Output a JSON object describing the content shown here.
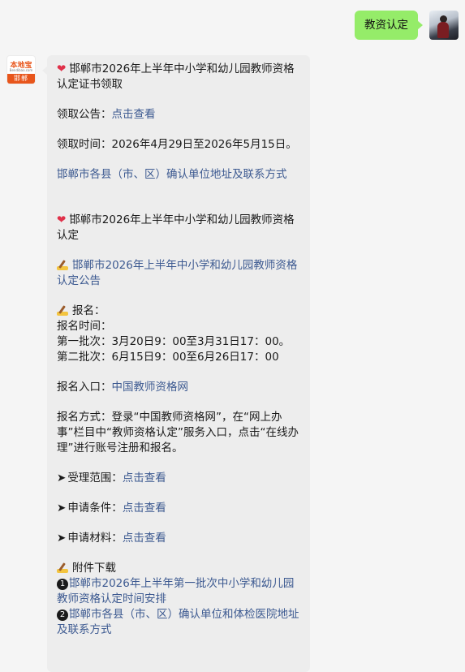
{
  "user_message": "教资认定",
  "bot_avatar": {
    "brand": "本地宝",
    "site": "Bendibao.com",
    "city": "邯郸"
  },
  "message": {
    "cert": {
      "title": "邯郸市2026年上半年中小学和幼儿园教师资格认定证书领取",
      "notice_label": "领取公告：",
      "notice_link": "点击查看",
      "time": "领取时间：2026年4月29日至2026年5月15日。",
      "address_link": "邯郸市各县（市、区）确认单位地址及联系方式"
    },
    "recog": {
      "title": "邯郸市2026年上半年中小学和幼儿园教师资格认定",
      "announcement_link": "邯郸市2026年上半年中小学和幼儿园教师资格认定公告",
      "signup_heading": "报名：",
      "signup_time_label": "报名时间：",
      "batch1": "第一批次：3月20日9：00至3月31日17：00。",
      "batch2": "第二批次：6月15日9：00至6月26日17：00",
      "entry_label": "报名入口：",
      "entry_link": "中国教师资格网",
      "method": "报名方式：登录“中国教师资格网”，在“网上办事”栏目中“教师资格认定”服务入口，点击“在线办理”进行账号注册和报名。",
      "scope_label": "受理范围：",
      "scope_link": "点击查看",
      "conditions_label": "申请条件：",
      "conditions_link": "点击查看",
      "materials_label": "申请材料：",
      "materials_link": "点击查看",
      "attachments_heading": "附件下载",
      "attachment1": "邯郸市2026年上半年第一批次中小学和幼儿园教师资格认定时间安排",
      "attachment2": "邯郸市各县（市、区）确认单位和体检医院地址及联系方式",
      "attachment1_num": "1",
      "attachment2_num": "2"
    }
  }
}
